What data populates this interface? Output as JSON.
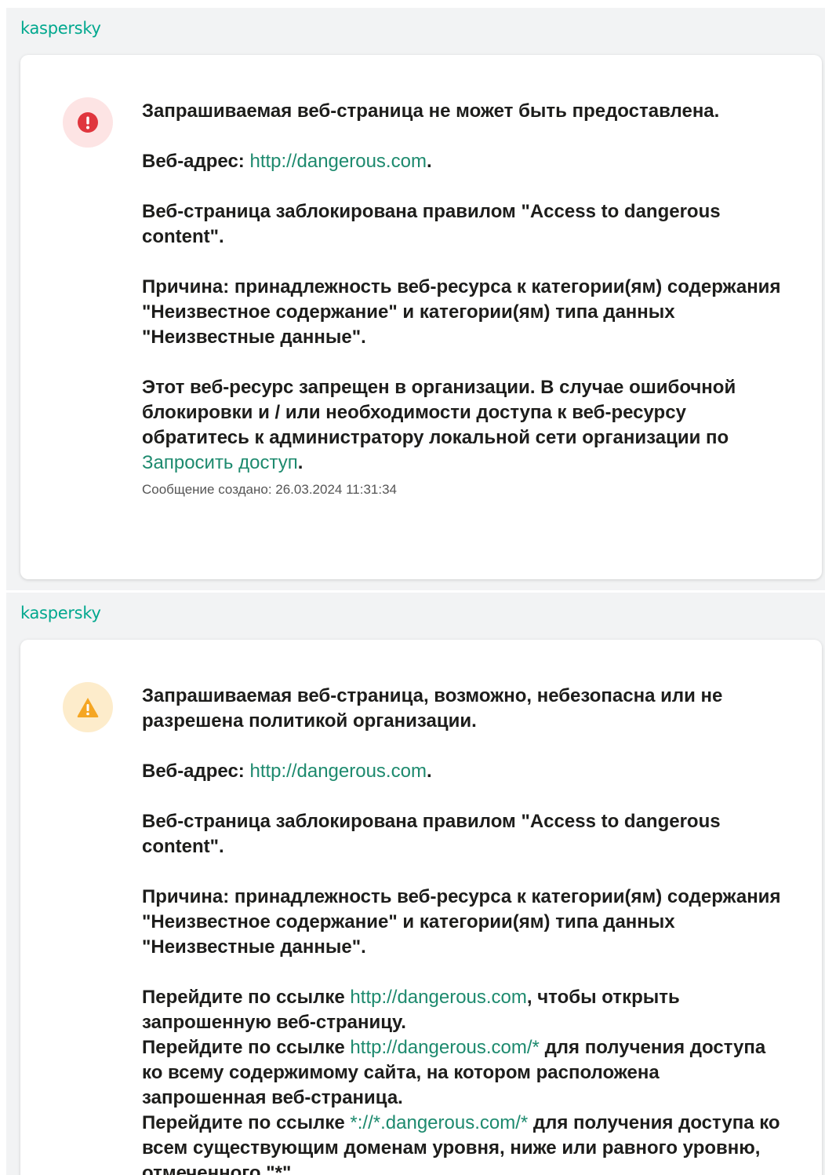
{
  "colors": {
    "brand": "#00a88e",
    "link": "#1d8a6e",
    "error": "#e0363e",
    "warning": "#f5a623"
  },
  "block": {
    "logo": "kaspersky",
    "title": "Запрашиваемая веб-страница не может быть предоставлена.",
    "addr_label": "Веб-адрес:",
    "addr_link": "http://dangerous.com",
    "rule": "Веб-страница заблокирована правилом \"Access to dangerous content\".",
    "reason": "Причина: принадлежность веб-ресурса к категории(ям) содержания \"Неизвестное содержание\" и категории(ям) типа данных \"Неизвестные данные\".",
    "contact_text": "Этот веб-ресурс запрещен в организации. В случае ошибочной блокировки и / или необходимости доступа к веб-ресурсу обратитесь к администратору локальной сети организации по",
    "contact_link": "Запросить доступ",
    "created": "Сообщение создано: 26.03.2024 11:31:34",
    "icon": "error-icon"
  },
  "warning": {
    "logo": "kaspersky",
    "title": "Запрашиваемая веб-страница, возможно, небезопасна или не разрешена политикой организации.",
    "addr_label": "Веб-адрес:",
    "addr_link": "http://dangerous.com",
    "rule": "Веб-страница заблокирована правилом \"Access to dangerous content\".",
    "reason": "Причина: принадлежность веб-ресурса к категории(ям) содержания \"Неизвестное содержание\" и категории(ям) типа данных \"Неизвестные данные\".",
    "goto_prefix": "Перейдите по ссылке",
    "link1": "http://dangerous.com",
    "link1_suffix": ", чтобы открыть запрошенную веб-страницу.",
    "link2": "http://dangerous.com/*",
    "link2_suffix": " для получения доступа ко всему содержимому сайта, на котором расположена запрошенная веб-страница.",
    "link3": "*://*.dangerous.com/*",
    "link3_suffix": " для получения доступа ко всем существующим доменам уровня, ниже или равного уровню, отмеченного \"*\".",
    "icon": "warning-icon"
  }
}
